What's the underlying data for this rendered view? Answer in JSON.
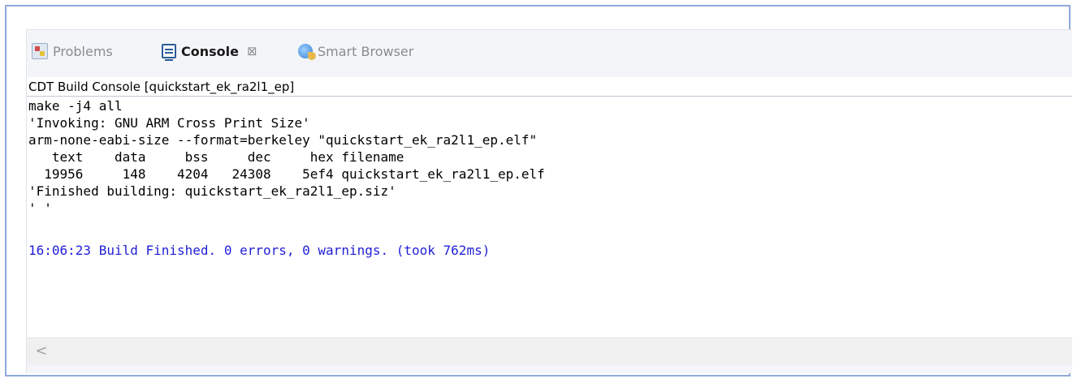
{
  "tabs": [
    {
      "label": "Problems",
      "icon": "problems-icon",
      "active": false
    },
    {
      "label": "Console",
      "icon": "console-icon",
      "active": true,
      "close": "⊠"
    },
    {
      "label": "Smart Browser",
      "icon": "globe-icon",
      "active": false
    }
  ],
  "console": {
    "title": "CDT Build Console [quickstart_ek_ra2l1_ep]",
    "lines": [
      "make -j4 all",
      "'Invoking: GNU ARM Cross Print Size'",
      "arm-none-eabi-size --format=berkeley \"quickstart_ek_ra2l1_ep.elf\"",
      "   text    data     bss     dec     hex filename",
      "  19956     148    4204   24308    5ef4 quickstart_ek_ra2l1_ep.elf",
      "'Finished building: quickstart_ek_ra2l1_ep.siz'",
      "' '",
      "",
      "16:06:23 Build Finished. 0 errors, 0 warnings. (took 762ms)"
    ]
  },
  "scrollbar": {
    "left_arrow": "<"
  },
  "colors": {
    "info_text": "#1f1fd6",
    "frame_border": "#8eaadb"
  }
}
